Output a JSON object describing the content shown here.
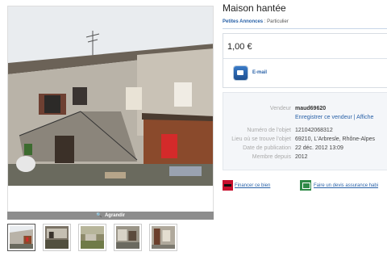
{
  "listing": {
    "title": "Maison hantée",
    "breadcrumb_link": "Petites Annonces",
    "breadcrumb_sep": ":",
    "breadcrumb_type": "Particulier",
    "price": "1,00 €",
    "email_label": "E-mail",
    "enlarge_label": "Agrandir"
  },
  "seller": {
    "vendor_key": "Vendeur",
    "vendor_value": "maud69620",
    "save_seller": "Enregistrer ce vendeur",
    "sep": "|",
    "show": "Affiche",
    "ref_key": "Numéro de l'objet",
    "ref_value": "121042068312",
    "location_key": "Lieu où se trouve l'objet",
    "location_value": "69210, L'Arbresle, Rhône-Alpes",
    "date_key": "Date de publication",
    "date_value": "22 déc. 2012 13:09",
    "member_key": "Membre depuis",
    "member_value": "2012"
  },
  "links": {
    "finance": "Financer ce bien",
    "insurance": "Faire un devis assurance habi"
  },
  "thumbnails": [
    "photo-1",
    "photo-2",
    "photo-3",
    "photo-4",
    "photo-5"
  ],
  "colors": {
    "link": "#2a62a8",
    "red_badge": "#c8102e",
    "green_badge": "#2f8a47"
  }
}
